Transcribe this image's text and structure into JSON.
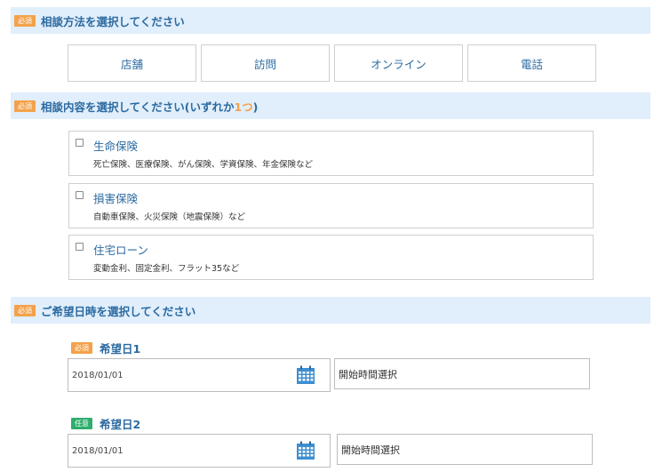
{
  "sections": {
    "method": {
      "badge": "必須",
      "title": "相談方法を選択してください"
    },
    "content": {
      "badge": "必須",
      "title_main": "相談内容を選択してください(いずれか",
      "title_accent": "1つ",
      "title_end": ")"
    },
    "datetime": {
      "badge": "必須",
      "title": "ご希望日時を選択してください"
    }
  },
  "methods": [
    "店舗",
    "訪問",
    "オンライン",
    "電話"
  ],
  "consult_options": [
    {
      "title": "生命保険",
      "desc": "死亡保険、医療保険、がん保険、学資保険、年金保険など",
      "checked": false
    },
    {
      "title": "損害保険",
      "desc": "自動車保険、火災保険（地震保険）など",
      "checked": false
    },
    {
      "title": "住宅ローン",
      "desc": "変動金利、固定金利、フラット35など",
      "checked": false
    }
  ],
  "dates": [
    {
      "badge": "必須",
      "badge_type": "required",
      "label": "希望日1",
      "date": "2018/01/01",
      "time": "開始時間選択"
    },
    {
      "badge": "任意",
      "badge_type": "optional",
      "label": "希望日2",
      "date": "2018/01/01",
      "time": "開始時間選択"
    }
  ],
  "icons": {
    "calendar": "calendar-icon"
  },
  "colors": {
    "accent": "#2b6aa0",
    "required": "#f3a24b",
    "optional": "#2eae6c",
    "header_bg": "#e1eefb"
  }
}
